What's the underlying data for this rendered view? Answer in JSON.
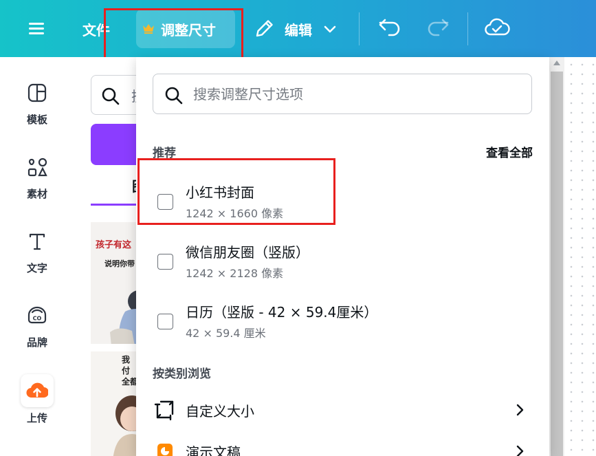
{
  "topbar": {
    "file_label": "文件",
    "resize_label": "调整尺寸",
    "edit_label": "编辑",
    "crown_color": "#f5b82e",
    "gradient_colors": [
      "#16c3c9",
      "#2b8fd9"
    ]
  },
  "rail": {
    "items": [
      {
        "label": "模板",
        "icon": "template-icon"
      },
      {
        "label": "素材",
        "icon": "elements-icon"
      },
      {
        "label": "文字",
        "icon": "text-icon"
      },
      {
        "label": "品牌",
        "icon": "brand-icon"
      },
      {
        "label": "上传",
        "icon": "upload-icon"
      }
    ],
    "upload_icon_color": "#ff6a1f"
  },
  "panel": {
    "search_partial": "搜",
    "tab_partial": "图",
    "thumb1_title": "孩子有这",
    "thumb1_subtitle": "说明你带",
    "thumb2_text": "我\n付\n全都",
    "accent_color": "#8b3dff"
  },
  "dropdown": {
    "search_placeholder": "搜索调整尺寸选项",
    "recommended_title": "推荐",
    "view_all_label": "查看全部",
    "options": [
      {
        "name": "小红书封面",
        "size": "1242 × 1660 像素",
        "checked": false
      },
      {
        "name": "微信朋友圈（竖版）",
        "size": "1242 × 2128 像素",
        "checked": false
      },
      {
        "name": "日历（竖版 - 42 × 59.4厘米）",
        "size": "42 × 59.4 厘米",
        "checked": false
      }
    ],
    "browse_title": "按类别浏览",
    "categories": [
      {
        "name": "自定义大小",
        "icon": "custom-size-icon"
      },
      {
        "name": "演示文稿",
        "icon": "presentation-icon",
        "icon_color": "#ff8a00"
      }
    ]
  },
  "highlight_color": "#e8201e"
}
